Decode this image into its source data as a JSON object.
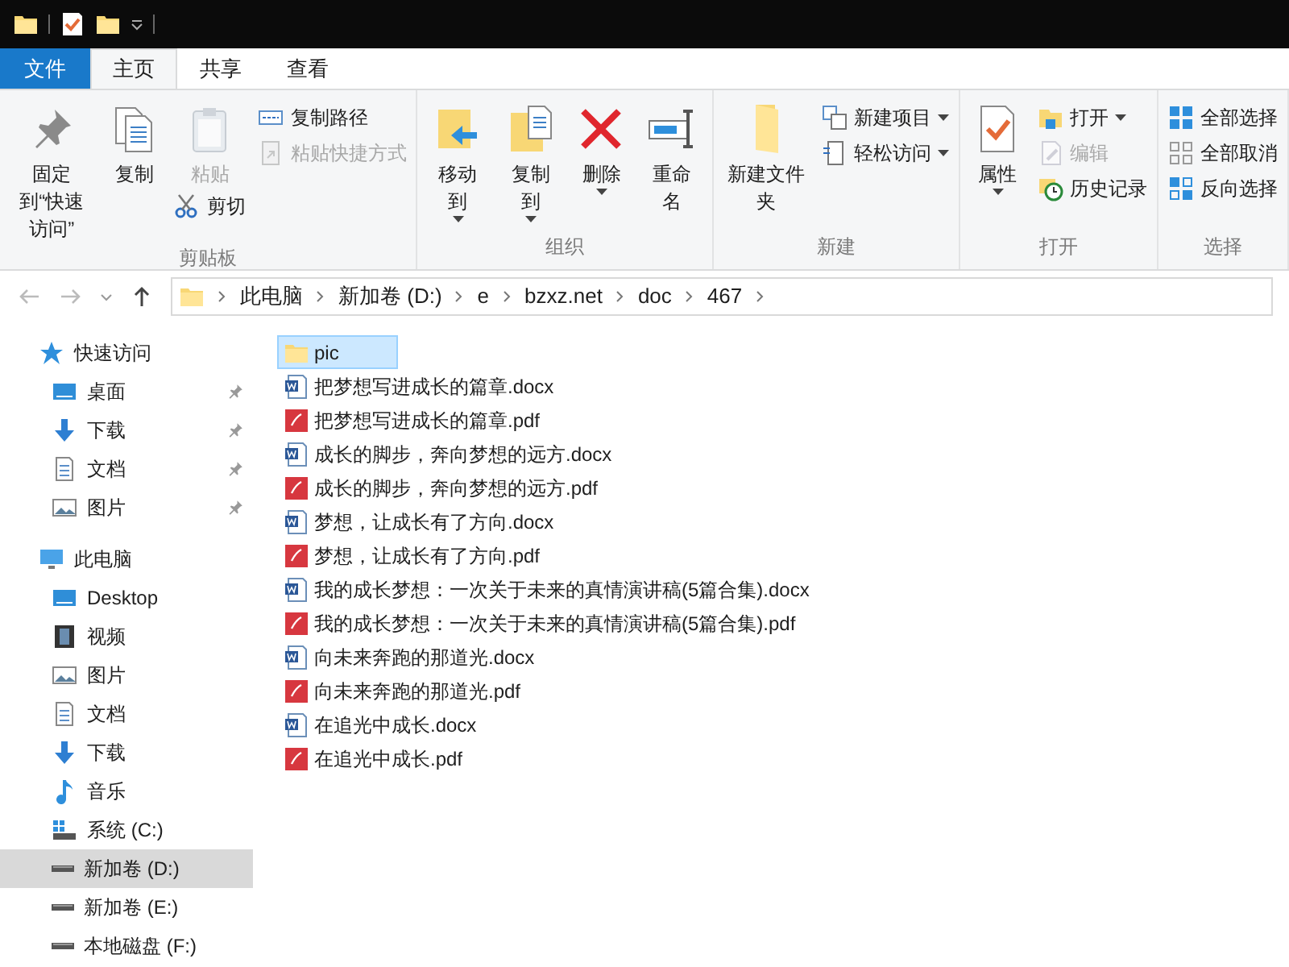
{
  "ribbon_tabs": [
    {
      "label": "文件",
      "kind": "file",
      "selected": false
    },
    {
      "label": "主页",
      "kind": "tab",
      "selected": true
    },
    {
      "label": "共享",
      "kind": "tab",
      "selected": false
    },
    {
      "label": "查看",
      "kind": "tab",
      "selected": false
    }
  ],
  "ribbon_groups": [
    {
      "label": "剪贴板",
      "columns": [
        {
          "items": [
            {
              "kind": "large",
              "label": "固定到“快速访问”",
              "disabled": false,
              "dropdown": false
            }
          ]
        },
        {
          "items": [
            {
              "kind": "large",
              "label": "复制",
              "disabled": false,
              "dropdown": false
            }
          ]
        },
        {
          "items": [
            {
              "kind": "large",
              "label": "粘贴",
              "disabled": true,
              "dropdown": false
            },
            {
              "kind": "small",
              "label": "剪切",
              "disabled": false,
              "dropdown": false
            }
          ]
        },
        {
          "items": [
            {
              "kind": "small",
              "label": "复制路径",
              "disabled": false,
              "dropdown": false
            },
            {
              "kind": "small",
              "label": "粘贴快捷方式",
              "disabled": true,
              "dropdown": false
            }
          ]
        }
      ]
    },
    {
      "label": "组织",
      "columns": [
        {
          "items": [
            {
              "kind": "large",
              "label": "移动到",
              "disabled": false,
              "dropdown": true
            }
          ]
        },
        {
          "items": [
            {
              "kind": "large",
              "label": "复制到",
              "disabled": false,
              "dropdown": true
            }
          ]
        },
        {
          "items": [
            {
              "kind": "large",
              "label": "删除",
              "disabled": false,
              "dropdown": true
            }
          ]
        },
        {
          "items": [
            {
              "kind": "large",
              "label": "重命名",
              "disabled": false,
              "dropdown": false
            }
          ]
        }
      ]
    },
    {
      "label": "新建",
      "columns": [
        {
          "items": [
            {
              "kind": "large",
              "label": "新建文件夹",
              "disabled": false,
              "dropdown": false
            }
          ]
        },
        {
          "items": [
            {
              "kind": "small",
              "label": "新建项目",
              "disabled": false,
              "dropdown": true
            },
            {
              "kind": "small",
              "label": "轻松访问",
              "disabled": false,
              "dropdown": true
            }
          ]
        }
      ]
    },
    {
      "label": "打开",
      "columns": [
        {
          "items": [
            {
              "kind": "large",
              "label": "属性",
              "disabled": false,
              "dropdown": true
            }
          ]
        },
        {
          "items": [
            {
              "kind": "small",
              "label": "打开",
              "disabled": false,
              "dropdown": true
            },
            {
              "kind": "small",
              "label": "编辑",
              "disabled": true,
              "dropdown": false
            },
            {
              "kind": "small",
              "label": "历史记录",
              "disabled": false,
              "dropdown": false
            }
          ]
        }
      ]
    },
    {
      "label": "选择",
      "columns": [
        {
          "items": [
            {
              "kind": "small",
              "label": "全部选择",
              "disabled": false,
              "dropdown": false
            },
            {
              "kind": "small",
              "label": "全部取消",
              "disabled": false,
              "dropdown": false
            },
            {
              "kind": "small",
              "label": "反向选择",
              "disabled": false,
              "dropdown": false
            }
          ]
        }
      ]
    }
  ],
  "address_bar": {
    "path": [
      "此电脑",
      "新加卷 (D:)",
      "e",
      "bzxz.net",
      "doc",
      "467"
    ]
  },
  "navigation": [
    {
      "label": "快速访问",
      "children": [
        {
          "label": "桌面",
          "pinned": true
        },
        {
          "label": "下载",
          "pinned": true
        },
        {
          "label": "文档",
          "pinned": true
        },
        {
          "label": "图片",
          "pinned": true
        }
      ]
    },
    {
      "label": "此电脑",
      "children": [
        {
          "label": "Desktop",
          "selected": false
        },
        {
          "label": "视频",
          "selected": false
        },
        {
          "label": "图片",
          "selected": false
        },
        {
          "label": "文档",
          "selected": false
        },
        {
          "label": "下载",
          "selected": false
        },
        {
          "label": "音乐",
          "selected": false
        },
        {
          "label": "系统 (C:)",
          "selected": false
        },
        {
          "label": "新加卷 (D:)",
          "selected": true
        },
        {
          "label": "新加卷 (E:)",
          "selected": false
        },
        {
          "label": "本地磁盘 (F:)",
          "selected": false
        }
      ]
    }
  ],
  "files": [
    {
      "name": "pic",
      "kind": "folder",
      "selected": true
    },
    {
      "name": "把梦想写进成长的篇章.docx",
      "kind": "docx",
      "selected": false
    },
    {
      "name": "把梦想写进成长的篇章.pdf",
      "kind": "pdf",
      "selected": false
    },
    {
      "name": "成长的脚步，奔向梦想的远方.docx",
      "kind": "docx",
      "selected": false
    },
    {
      "name": "成长的脚步，奔向梦想的远方.pdf",
      "kind": "pdf",
      "selected": false
    },
    {
      "name": "梦想，让成长有了方向.docx",
      "kind": "docx",
      "selected": false
    },
    {
      "name": "梦想，让成长有了方向.pdf",
      "kind": "pdf",
      "selected": false
    },
    {
      "name": "我的成长梦想：一次关于未来的真情演讲稿(5篇合集).docx",
      "kind": "docx",
      "selected": false
    },
    {
      "name": "我的成长梦想：一次关于未来的真情演讲稿(5篇合集).pdf",
      "kind": "pdf",
      "selected": false
    },
    {
      "name": "向未来奔跑的那道光.docx",
      "kind": "docx",
      "selected": false
    },
    {
      "name": "向未来奔跑的那道光.pdf",
      "kind": "pdf",
      "selected": false
    },
    {
      "name": "在追光中成长.docx",
      "kind": "docx",
      "selected": false
    },
    {
      "name": "在追光中成长.pdf",
      "kind": "pdf",
      "selected": false
    }
  ]
}
